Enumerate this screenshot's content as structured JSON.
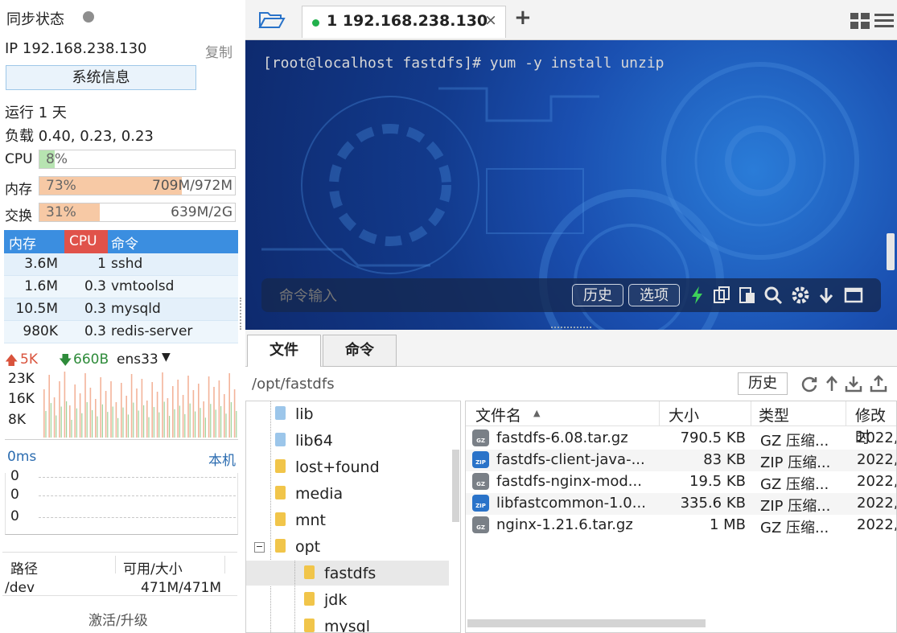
{
  "left_panel": {
    "sync_label": "同步状态",
    "ip_label": "IP 192.168.238.130",
    "copy_label": "复制",
    "sysinfo_button": "系统信息",
    "uptime": "运行 1 天",
    "load": "负载 0.40, 0.23, 0.23",
    "cpu": {
      "label": "CPU",
      "pct": "8%",
      "fraction": 0.08
    },
    "memory": {
      "label": "内存",
      "pct": "73%",
      "value": "709M/972M",
      "fraction": 0.73
    },
    "swap": {
      "label": "交换",
      "pct": "31%",
      "value": "639M/2G",
      "fraction": 0.31
    },
    "process_table": {
      "headers": [
        "内存",
        "CPU",
        "命令"
      ],
      "rows": [
        {
          "mem": "3.6M",
          "cpu": "1",
          "cmd": "sshd"
        },
        {
          "mem": "1.6M",
          "cpu": "0.3",
          "cmd": "vmtoolsd"
        },
        {
          "mem": "10.5M",
          "cpu": "0.3",
          "cmd": "mysqld"
        },
        {
          "mem": "980K",
          "cpu": "0.3",
          "cmd": "redis-server"
        }
      ]
    },
    "network": {
      "up": "5K",
      "down": "660B",
      "iface": "ens33",
      "y_labels": [
        "23K",
        "16K",
        "8K"
      ]
    },
    "latency": {
      "ms_label": "0ms",
      "host_label": "本机",
      "values": [
        "0",
        "0",
        "0"
      ]
    },
    "disk": {
      "headers": [
        "路径",
        "可用/大小"
      ],
      "rows": [
        {
          "path": "/dev",
          "size": "471M/471M"
        }
      ]
    },
    "activate_label": "激活/升级"
  },
  "terminal": {
    "tab_label": "1 192.168.238.130",
    "add_tab": "+",
    "prompt_line": "[root@localhost fastdfs]# yum -y install unzip",
    "cmd_placeholder": "命令输入",
    "history_btn": "历史",
    "options_btn": "选项"
  },
  "file_browser": {
    "tabs": [
      "文件",
      "命令"
    ],
    "path": "/opt/fastdfs",
    "history_btn": "历史",
    "tree": [
      {
        "name": "lib",
        "type": "link"
      },
      {
        "name": "lib64",
        "type": "link"
      },
      {
        "name": "lost+found",
        "type": "folder"
      },
      {
        "name": "media",
        "type": "folder"
      },
      {
        "name": "mnt",
        "type": "folder"
      },
      {
        "name": "opt",
        "type": "folder-open"
      },
      {
        "name": "fastdfs",
        "type": "folder"
      },
      {
        "name": "jdk",
        "type": "folder"
      },
      {
        "name": "mysql",
        "type": "folder"
      }
    ],
    "columns": [
      "文件名",
      "大小",
      "类型",
      "修改时"
    ],
    "files": [
      {
        "name": "fastdfs-6.08.tar.gz",
        "size": "790.5 KB",
        "type": "GZ 压缩...",
        "modified": "2022,",
        "icon": "gz"
      },
      {
        "name": "fastdfs-client-java-...",
        "size": "83 KB",
        "type": "ZIP 压缩...",
        "modified": "2022,",
        "icon": "zip"
      },
      {
        "name": "fastdfs-nginx-mod...",
        "size": "19.5 KB",
        "type": "GZ 压缩...",
        "modified": "2022,",
        "icon": "gz"
      },
      {
        "name": "libfastcommon-1.0...",
        "size": "335.6 KB",
        "type": "ZIP 压缩...",
        "modified": "2022,",
        "icon": "zip"
      },
      {
        "name": "nginx-1.21.6.tar.gz",
        "size": "1 MB",
        "type": "GZ 压缩...",
        "modified": "2022,",
        "icon": "gz"
      }
    ]
  },
  "colors": {
    "accent_blue": "#3b8ee0",
    "cpu_red": "#e0524a",
    "mem_orange": "#f7c9a5",
    "cpu_green": "#b7e4b1",
    "upload_red": "#d9533c",
    "download_green": "#2e8b3a"
  }
}
